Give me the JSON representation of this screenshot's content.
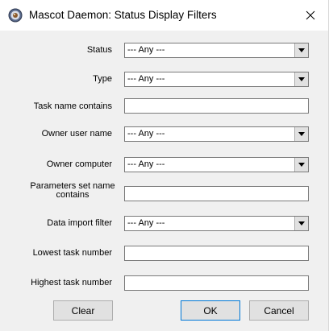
{
  "window": {
    "title": "Mascot Daemon: Status Display Filters",
    "icon": "mascot-daemon-app-icon",
    "close_icon": "close-icon"
  },
  "filters": {
    "status": {
      "label": "Status",
      "value": "--- Any ---"
    },
    "type": {
      "label": "Type",
      "value": "--- Any ---"
    },
    "task_name": {
      "label": "Task name contains",
      "value": ""
    },
    "owner_user": {
      "label": "Owner user name",
      "value": "--- Any ---"
    },
    "owner_computer": {
      "label": "Owner computer",
      "value": "--- Any ---"
    },
    "param_set": {
      "label": "Parameters set name contains",
      "value": ""
    },
    "data_import": {
      "label": "Data import filter",
      "value": "--- Any ---"
    },
    "lowest_task": {
      "label": "Lowest task number",
      "value": ""
    },
    "highest_task": {
      "label": "Highest task number",
      "value": ""
    }
  },
  "buttons": {
    "clear": "Clear",
    "ok": "OK",
    "cancel": "Cancel"
  },
  "colors": {
    "dialog_bg": "#f0f0f0",
    "titlebar_bg": "#ffffff",
    "default_button_border": "#0078d7"
  }
}
